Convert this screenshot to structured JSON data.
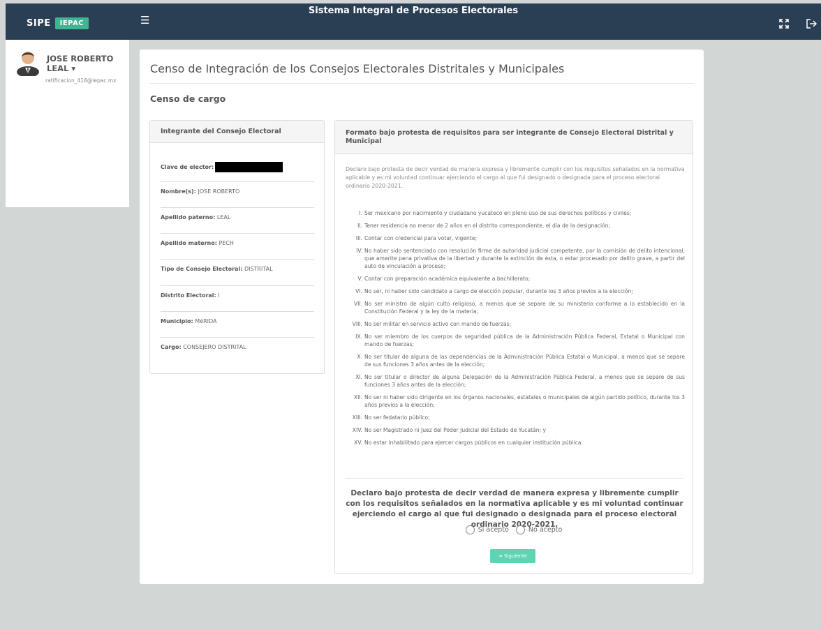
{
  "header": {
    "brand": "SIPE",
    "brand_badge": "IEPAC",
    "app_title": "Sistema Integral de Procesos Electorales"
  },
  "user": {
    "name_line1": "JOSE ROBERTO",
    "name_line2": "LEAL ▾",
    "email": "ratificacion_418@iepac.mx"
  },
  "page": {
    "title": "Censo de Integración de los Consejos Electorales Distritales y Municipales",
    "subtitle": "Censo de cargo"
  },
  "member_card": {
    "heading": "Integrante del Consejo Electoral",
    "fields": [
      {
        "label": "Clave de elector:",
        "value": ""
      },
      {
        "label": "Nombre(s):",
        "value": "JOSE ROBERTO"
      },
      {
        "label": "Apellido paterno:",
        "value": "LEAL"
      },
      {
        "label": "Apellido materno:",
        "value": "PECH"
      },
      {
        "label": "Tipo de Consejo Electoral:",
        "value": "DISTRITAL"
      },
      {
        "label": "Distrito Electoral:",
        "value": "I"
      },
      {
        "label": "Municipio:",
        "value": "MéRIDA"
      },
      {
        "label": "Cargo:",
        "value": "CONSEJERO DISTRITAL"
      }
    ]
  },
  "format_card": {
    "heading": "Formato bajo protesta de requisitos para ser integrante de Consejo Electoral Distrital y Municipal",
    "declaration_small": "Declaro bajo protesta de decir verdad de manera expresa y libremente cumplir con los requisitos señalados en la normativa aplicable y es mi voluntad continuar ejerciendo el cargo al que fui designado o designada para el proceso electoral ordinario 2020-2021.",
    "requirements": [
      {
        "num": "I.",
        "text": "Ser mexicano por nacimiento y ciudadano yucateco en pleno uso de sus derechos políticos y civiles;"
      },
      {
        "num": "II.",
        "text": "Tener residencia no menor de 2 años en el distrito correspondiente, el día de la designación;"
      },
      {
        "num": "III.",
        "text": "Contar con credencial para votar, vigente;"
      },
      {
        "num": "IV.",
        "text": "No haber sido sentenciado con resolución firme de autoridad judicial competente, por la comisión de delito intencional, que amerite pena privativa de la libertad y durante la extinción de ésta, o estar procesado por delito grave, a partir del auto de vinculación a proceso;"
      },
      {
        "num": "V.",
        "text": "Contar con preparación académica equivalente a bachillerato;"
      },
      {
        "num": "VI.",
        "text": "No ser, ni haber sido candidato a cargo de elección popular, durante los 3 años previos a la elección;"
      },
      {
        "num": "VII.",
        "text": "No ser ministro de algún culto religioso, a menos que se separe de su ministerio conforme a lo establecido en la Constitución Federal y la ley de la materia;"
      },
      {
        "num": "VIII.",
        "text": "No ser militar en servicio activo con mando de fuerzas;"
      },
      {
        "num": "IX.",
        "text": "No ser miembro de los cuerpos de seguridad pública de la Administración Pública Federal, Estatal o Municipal con mando de fuerzas;"
      },
      {
        "num": "X.",
        "text": "No ser titular de alguna de las dependencias de la Administración Pública Estatal o Municipal, a menos que se separe de sus funciones 3 años antes de la elección;"
      },
      {
        "num": "XI.",
        "text": "No ser titular o director de alguna Delegación de la Administración Pública Federal, a menos que se separe de sus funciones 3 años antes de la elección;"
      },
      {
        "num": "XII.",
        "text": "No ser ni haber sido dirigente en los órganos nacionales, estatales o municipales de algún partido político, durante los 3 años previos a la elección;"
      },
      {
        "num": "XIII.",
        "text": "No ser fedatario público;"
      },
      {
        "num": "XIV.",
        "text": "No ser Magistrado ni Juez del Poder Judicial del Estado de Yucatán; y"
      },
      {
        "num": "XV.",
        "text": "No estar inhabilitado para ejercer cargos públicos en cualquier institución pública."
      }
    ],
    "declaration_big": "Declaro bajo protesta de decir verdad de manera expresa y libremente cumplir con los requisitos señalados en la normativa aplicable y es mi voluntad continuar ejerciendo el cargo al que fui designado o designada para el proceso electoral ordinario 2020-2021.",
    "accept_label": "Sí acepto",
    "reject_label": "No acepto",
    "next_button": "➔ Siguiente"
  }
}
